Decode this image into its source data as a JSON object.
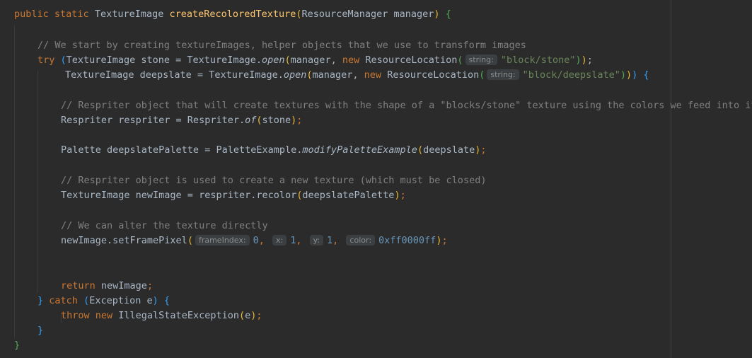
{
  "code": {
    "l1": {
      "kw_public": "public",
      "kw_static": "static",
      "type": "TextureImage",
      "method": "createRecoloredTexture",
      "open_paren": "(",
      "param": "ResourceManager manager",
      "close_paren": ")",
      "brace": "{"
    },
    "l2": {
      "comment": "// We start by creating textureImages, helper objects that we use to transform images"
    },
    "l3": {
      "kw_try": "try",
      "paren_open": "(",
      "decl": "TextureImage stone = TextureImage.",
      "method": "open",
      "paren2_open": "(",
      "args": "manager, ",
      "kw_new": "new",
      "ctor": " ResourceLocation",
      "paren3_open": "(",
      "hint": "string:",
      "str": "\"block/stone\"",
      "paren3_close": ")",
      "paren2_close": ")",
      "semi": ";"
    },
    "l4": {
      "decl": "TextureImage deepslate = TextureImage.",
      "method": "open",
      "paren2_open": "(",
      "args": "manager, ",
      "kw_new": "new",
      "ctor": " ResourceLocation",
      "paren3_open": "(",
      "hint": "string:",
      "str": "\"block/deepslate\"",
      "paren3_close": ")",
      "paren2_close": ")",
      "paren1_close": ")",
      "brace": "{"
    },
    "l5": {
      "comment": "// Respriter object that will create textures with the shape of a \"blocks/stone\" texture using the colors we feed into it"
    },
    "l6": {
      "decl": "Respriter respriter = Respriter.",
      "method": "of",
      "paren_open": "(",
      "arg": "stone",
      "paren_close": ")",
      "semi": ";"
    },
    "l7": {
      "decl": "Palette deepslatePalette = PaletteExample.",
      "method": "modifyPaletteExample",
      "paren_open": "(",
      "arg": "deepslate",
      "paren_close": ")",
      "semi": ";"
    },
    "l8": {
      "comment": "// Respriter object is used to create a new texture (which must be closed)"
    },
    "l9": {
      "decl": "TextureImage newImage = respriter.recolor",
      "paren_open": "(",
      "arg": "deepslatePalette",
      "paren_close": ")",
      "semi": ";"
    },
    "l10": {
      "comment": "// We can alter the texture directly"
    },
    "l11": {
      "call": "newImage.setFramePixel",
      "paren_open": "(",
      "hint1": "frameIndex:",
      "v1": "0",
      "sep1": ", ",
      "hint2": "x:",
      "v2": "1",
      "sep2": ", ",
      "hint3": "y:",
      "v3": "1",
      "sep3": ", ",
      "hint4": "color:",
      "v4": "0xff0000ff",
      "paren_close": ")",
      "semi": ";"
    },
    "l12": {
      "kw_return": "return",
      "val": " newImage",
      "semi": ";"
    },
    "l13": {
      "close": "}",
      "kw_catch": " catch",
      "paren_open": " (",
      "param": "Exception e",
      "paren_close": ")",
      "brace": " {"
    },
    "l14": {
      "kw_throw": "throw",
      "kw_new": " new",
      "ctor": " IllegalStateException",
      "paren_open": "(",
      "arg": "e",
      "paren_close": ")",
      "semi": ";"
    },
    "l15": {
      "brace": "}"
    },
    "l16": {
      "brace": "}"
    }
  }
}
